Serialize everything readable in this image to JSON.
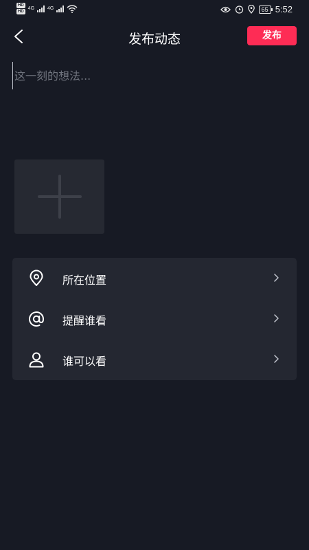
{
  "status_bar": {
    "hd_top": "HD",
    "hd_bottom": "HD",
    "net_1": "4G",
    "net_2": "4G",
    "battery": "65",
    "time": "5:52"
  },
  "header": {
    "title": "发布动态",
    "publish_label": "发布"
  },
  "composer": {
    "placeholder": "这一刻的想法...",
    "value": ""
  },
  "settings": {
    "items": [
      {
        "label": "所在位置",
        "icon": "location-pin-icon"
      },
      {
        "label": "提醒谁看",
        "icon": "at-sign-icon"
      },
      {
        "label": "谁可以看",
        "icon": "user-icon"
      }
    ]
  },
  "colors": {
    "background": "#171a24",
    "card": "#242731",
    "accent": "#fe2c55"
  }
}
